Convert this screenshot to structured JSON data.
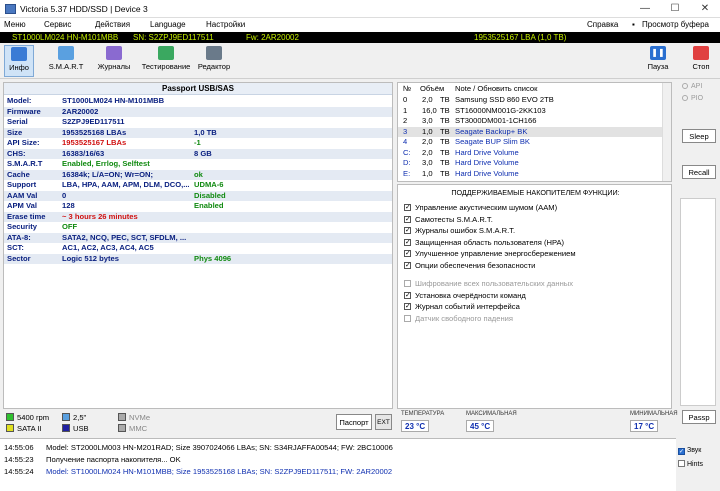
{
  "window": {
    "title": "Victoria 5.37 HDD/SSD | Device 3"
  },
  "menu": [
    "Меню",
    "Сервис",
    "Действия",
    "Language",
    "Настройки",
    "Справка",
    "Просмотр буфера"
  ],
  "devbar": {
    "device": "ST1000LM024 HN-M101MBB",
    "sn": "SN: S2ZPJ9ED117511",
    "fw": "Fw: 2AR20002",
    "lba": "1953525167 LBA (1,0 TB)"
  },
  "toolbar": {
    "info": "Инфо",
    "smart": "S.M.A.R.T",
    "journals": "Журналы",
    "testing": "Тестирование",
    "editor": "Редактор",
    "pause": "Пауза",
    "stop": "Стоп"
  },
  "passport": {
    "header": "Passport USB/SAS",
    "rows": [
      {
        "label": "Model:",
        "value": "ST1000LM024 HN-M101MBB",
        "value2": ""
      },
      {
        "label": "Firmware",
        "value": "2AR20002",
        "value2": ""
      },
      {
        "label": "Serial",
        "value": "S2ZPJ9ED117511",
        "value2": ""
      },
      {
        "label": "Size",
        "value": "1953525168 LBAs",
        "value2": "1,0 TB"
      },
      {
        "label": "API Size:",
        "value": "1953525167 LBAs",
        "value2": "-1"
      },
      {
        "label": "CHS:",
        "value": "16383/16/63",
        "value2": "8 GB"
      },
      {
        "label": "S.M.A.R.T",
        "value": "Enabled, Errlog, Selftest",
        "value2": ""
      },
      {
        "label": "Cache",
        "value": "16384k; L/A=ON; Wr=ON;",
        "value2": "ok"
      },
      {
        "label": "Support",
        "value": "LBA, HPA, AAM, APM, DLM, DCO,...",
        "value2": "UDMA-6"
      },
      {
        "label": "AAM Val",
        "value": "0",
        "value2": "Disabled"
      },
      {
        "label": "APM Val",
        "value": "128",
        "value2": "Enabled"
      },
      {
        "label": "Erase time",
        "value": "~ 3 hours 26 minutes",
        "value2": ""
      },
      {
        "label": "Security",
        "value": "OFF",
        "value2": ""
      },
      {
        "label": "ATA-8:",
        "value": "SATA2, NCQ, PEC, SCT, SFDLM, ...",
        "value2": ""
      },
      {
        "label": "SCT:",
        "value": "AC1, AC2, AC3, AC4, AC5",
        "value2": ""
      },
      {
        "label": "Sector",
        "value": "Logic 512 bytes",
        "value2": "Phys 4096"
      }
    ]
  },
  "drives": {
    "head": {
      "num": "№",
      "vol": "Объём",
      "note": "Note / Обновить список"
    },
    "rows": [
      {
        "num": "0",
        "vol": "2,0",
        "unit": "TB",
        "name": "Samsung SSD 860 EVO 2TB"
      },
      {
        "num": "1",
        "vol": "16,0",
        "unit": "TB",
        "name": "ST16000NM001G-2KK103"
      },
      {
        "num": "2",
        "vol": "3,0",
        "unit": "TB",
        "name": "ST3000DM001-1CH166"
      },
      {
        "num": "3",
        "vol": "1,0",
        "unit": "TB",
        "name": "Seagate Backup+ BK"
      },
      {
        "num": "4",
        "vol": "2,0",
        "unit": "TB",
        "name": "Seagate BUP Slim BK"
      },
      {
        "num": "C:",
        "vol": "2,0",
        "unit": "TB",
        "name": "Hard Drive Volume"
      },
      {
        "num": "D:",
        "vol": "3,0",
        "unit": "TB",
        "name": "Hard Drive Volume"
      },
      {
        "num": "E:",
        "vol": "1,0",
        "unit": "TB",
        "name": "Hard Drive Volume"
      }
    ]
  },
  "features": {
    "header": "ПОДДЕРЖИВАЕМЫЕ НАКОПИТЕЛЕМ ФУНКЦИИ:",
    "items": [
      {
        "label": "Управление акустическим шумом (AAM)",
        "checked": "✓",
        "enabled": true
      },
      {
        "label": "Самотесты S.M.A.R.T.",
        "checked": "✓",
        "enabled": true
      },
      {
        "label": "Журналы ошибок S.M.A.R.T.",
        "checked": "✓",
        "enabled": true
      },
      {
        "label": "Защищенная область пользователя (HPA)",
        "checked": "✓",
        "enabled": true
      },
      {
        "label": "Улучшенное управление энергосбережением",
        "checked": "✓",
        "enabled": true
      },
      {
        "label": "Опции обеспечения безопасности",
        "checked": "✓",
        "enabled": true
      },
      {
        "label": "Шифрование всех пользовательских данных",
        "checked": "",
        "enabled": false
      },
      {
        "label": "Установка очерёдности команд",
        "checked": "✓",
        "enabled": true
      },
      {
        "label": "Журнал событий интерфейса",
        "checked": "✓",
        "enabled": true
      },
      {
        "label": "Датчик свободного падения",
        "checked": "",
        "enabled": false
      }
    ]
  },
  "right": {
    "api": "API",
    "pio": "PIO",
    "sleep": "Sleep",
    "recall": "Recall",
    "passp": "Passp"
  },
  "legend": {
    "rpm": "5400 rpm",
    "size": "2,5\"",
    "nvme": "NVMe",
    "sata": "SATA II",
    "usb": "USB",
    "mmc": "MMC"
  },
  "buttons": {
    "passport": "Паспорт",
    "ext": "EXT"
  },
  "temps": {
    "temp_label": "ТЕМПЕРАТУРА",
    "temp_val": "23 °C",
    "max_label": "МАКСИМАЛЬНАЯ",
    "max_val": "45 °C",
    "min_label": "МИНИМАЛЬНАЯ",
    "min_val": "17 °C"
  },
  "log": [
    {
      "time": "14:55:06",
      "text": "Model: ST2000LM003 HN-M201RAD; Size 3907024066 LBAs; SN: S34RJAFFA00544; FW: 2BC10006",
      "color": "#000000"
    },
    {
      "time": "14:55:23",
      "text": "Получение паспорта накопителя... OK",
      "color": "#000000"
    },
    {
      "time": "14:55:24",
      "text": "Model: ST1000LM024 HN-M101MBB; Size 1953525168 LBAs; SN: S2ZPJ9ED117511; FW: 2AR20002",
      "color": "#1030b0"
    }
  ],
  "logside": {
    "sound": "Звук",
    "hints": "Hints"
  }
}
